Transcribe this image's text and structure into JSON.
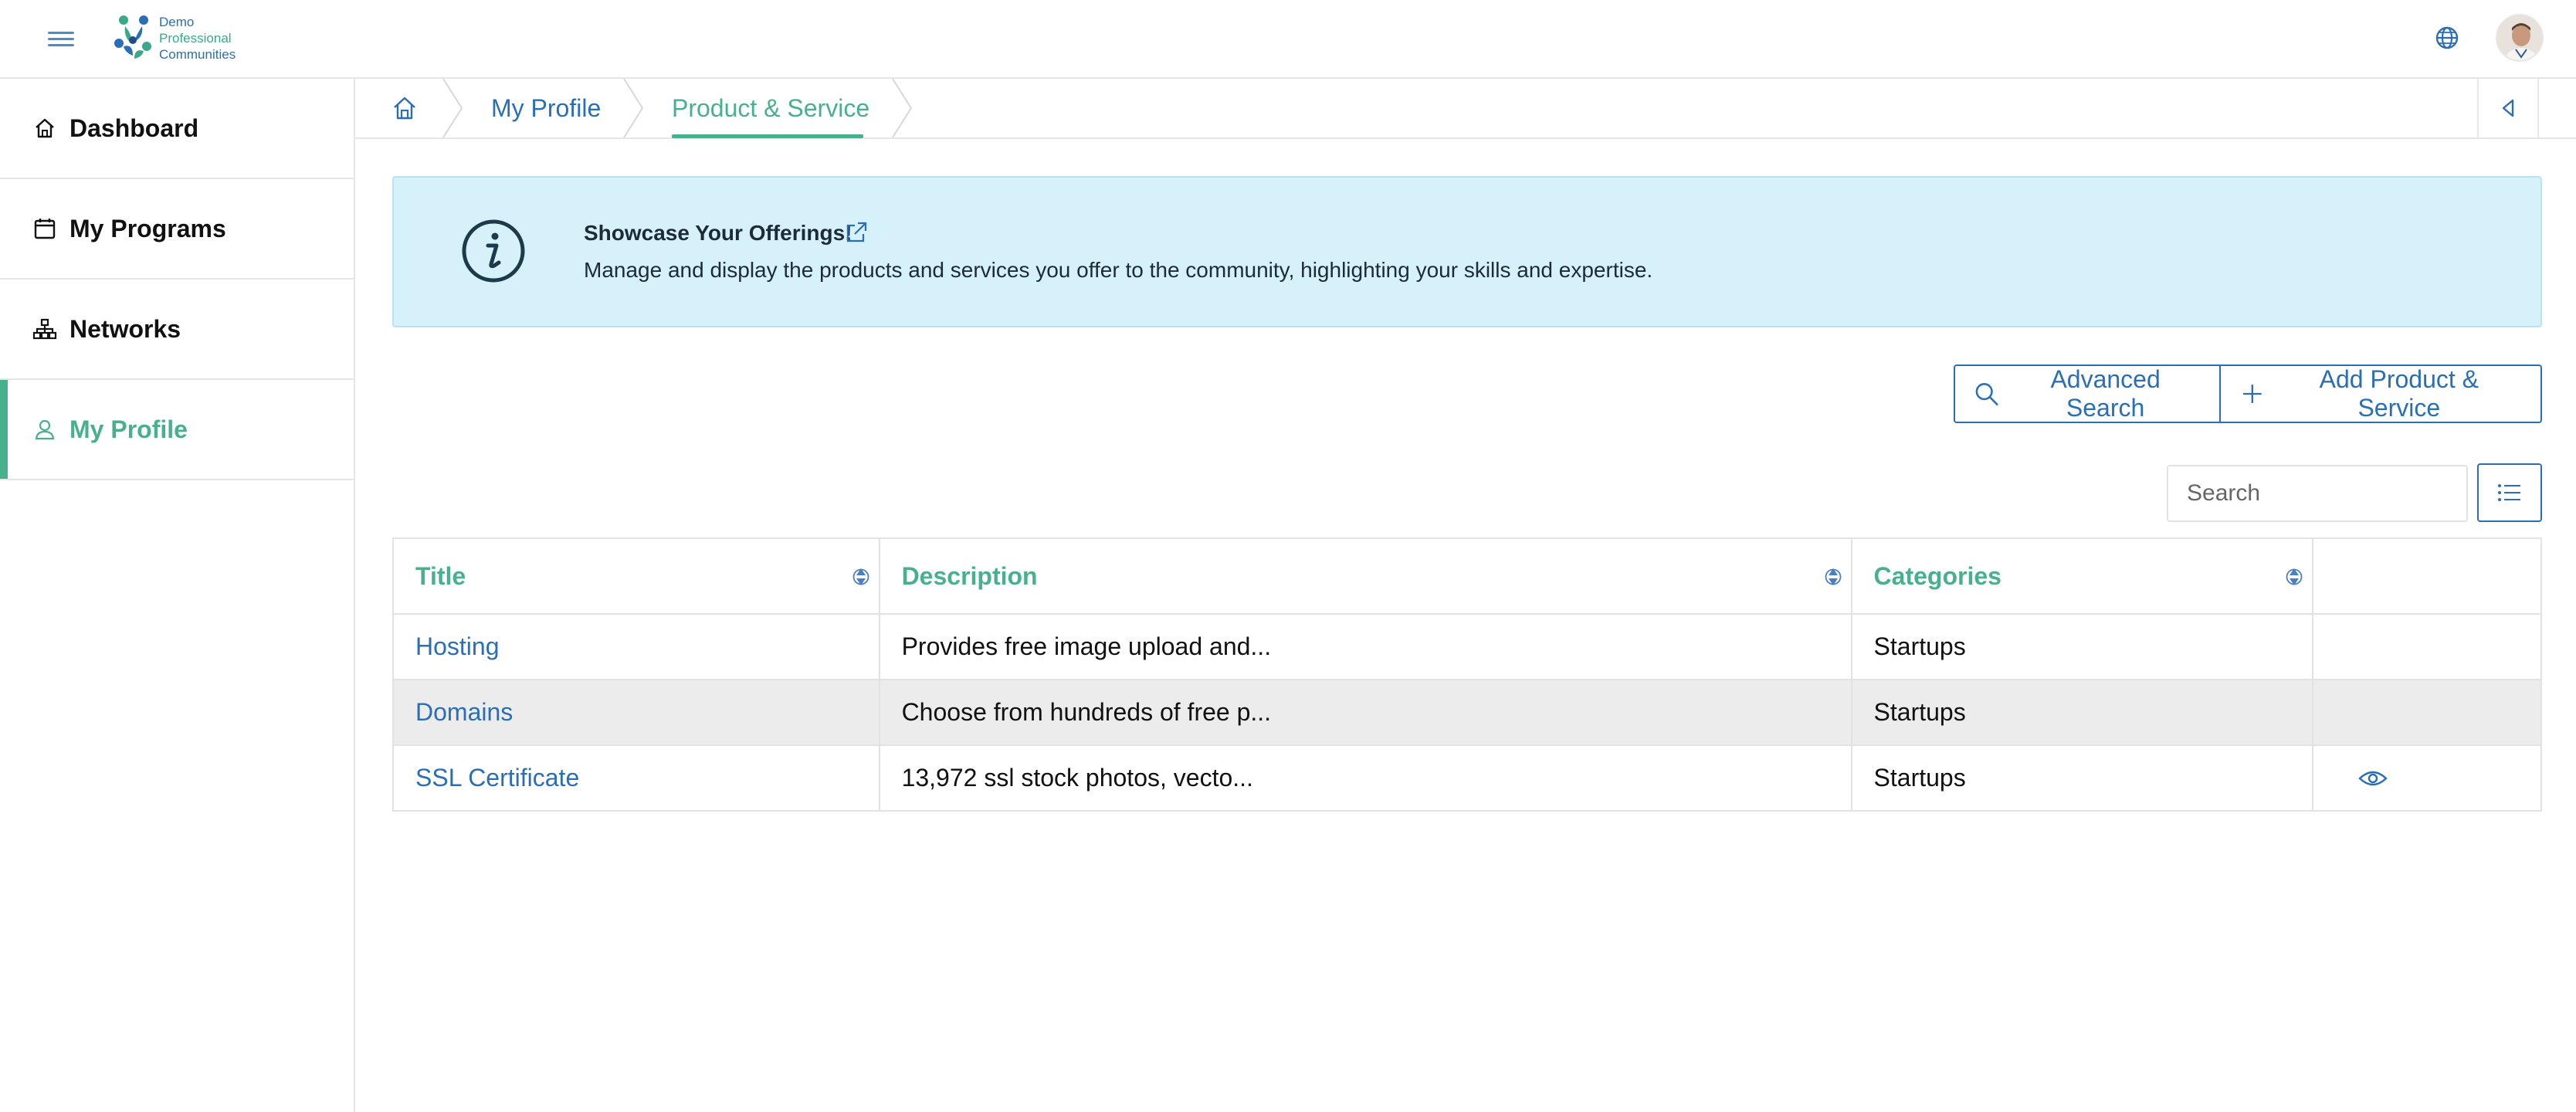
{
  "header": {
    "logo_line1": "Demo",
    "logo_line2": "Professional",
    "logo_line3": "Communities"
  },
  "sidebar": {
    "items": [
      {
        "label": "Dashboard",
        "icon": "home-icon"
      },
      {
        "label": "My Programs",
        "icon": "calendar-icon"
      },
      {
        "label": "Networks",
        "icon": "network-icon"
      },
      {
        "label": "My Profile",
        "icon": "user-icon",
        "active": true
      }
    ]
  },
  "breadcrumb": {
    "items": [
      {
        "label": "My Profile"
      },
      {
        "label": "Product & Service",
        "active": true
      }
    ]
  },
  "banner": {
    "title": "Showcase Your Offerings!",
    "description": "Manage and display the products and services you offer to the community, highlighting your skills and expertise."
  },
  "actions": {
    "advanced_search": "Advanced Search",
    "add_product": "Add Product & Service"
  },
  "search": {
    "placeholder": "Search"
  },
  "table": {
    "columns": [
      "Title",
      "Description",
      "Categories"
    ],
    "rows": [
      {
        "title": "Hosting",
        "description": "Provides free image upload and...",
        "category": "Startups"
      },
      {
        "title": "Domains",
        "description": "Choose from hundreds of free p...",
        "category": "Startups"
      },
      {
        "title": "SSL Certificate",
        "description": "13,972 ssl stock photos, vecto...",
        "category": "Startups"
      }
    ]
  },
  "colors": {
    "accent_green": "#49b08e",
    "link_blue": "#2a6fb5",
    "banner_bg": "#d6f1f9"
  }
}
